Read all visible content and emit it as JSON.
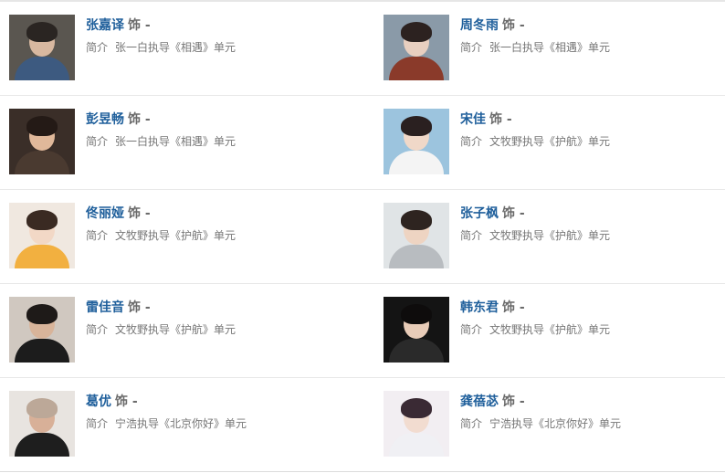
{
  "role_suffix": "饰 -",
  "intro_label": "简介",
  "cast": [
    {
      "name": "张嘉译",
      "intro": "张一白执导《相遇》单元",
      "colors": {
        "bg": "#5a5650",
        "skin": "#d8b8a0",
        "hair": "#2a2522",
        "shirt": "#3d5a80"
      }
    },
    {
      "name": "周冬雨",
      "intro": "张一白执导《相遇》单元",
      "colors": {
        "bg": "#8a9aa8",
        "skin": "#e8cfc0",
        "hair": "#2c2220",
        "shirt": "#8a3a2a"
      }
    },
    {
      "name": "彭昱畅",
      "intro": "张一白执导《相遇》单元",
      "colors": {
        "bg": "#3a2e28",
        "skin": "#e0b89a",
        "hair": "#241a16",
        "shirt": "#4a3a30"
      }
    },
    {
      "name": "宋佳",
      "intro": "文牧野执导《护航》单元",
      "colors": {
        "bg": "#9cc4de",
        "skin": "#f0d8c8",
        "hair": "#2a2020",
        "shirt": "#f4f4f4"
      }
    },
    {
      "name": "佟丽娅",
      "intro": "文牧野执导《护航》单元",
      "colors": {
        "bg": "#f0e8e0",
        "skin": "#f2d8c6",
        "hair": "#3a2a22",
        "shirt": "#f2b040"
      }
    },
    {
      "name": "张子枫",
      "intro": "文牧野执导《护航》单元",
      "colors": {
        "bg": "#e0e4e6",
        "skin": "#eed4c2",
        "hair": "#2e2420",
        "shirt": "#b8bcc0"
      }
    },
    {
      "name": "雷佳音",
      "intro": "文牧野执导《护航》单元",
      "colors": {
        "bg": "#d0c8c0",
        "skin": "#d8b49a",
        "hair": "#1e1a18",
        "shirt": "#1c1c1c"
      }
    },
    {
      "name": "韩东君",
      "intro": "文牧野执导《护航》单元",
      "colors": {
        "bg": "#141414",
        "skin": "#e8ccb8",
        "hair": "#0e0c0c",
        "shirt": "#2a2a2a"
      }
    },
    {
      "name": "葛优",
      "intro": "宁浩执导《北京你好》单元",
      "colors": {
        "bg": "#e8e4e0",
        "skin": "#d8b098",
        "hair": "#bca898",
        "shirt": "#1e1e1e"
      }
    },
    {
      "name": "龚蓓苾",
      "intro": "宁浩执导《北京你好》单元",
      "colors": {
        "bg": "#f2eef2",
        "skin": "#f2dcd0",
        "hair": "#3a2a34",
        "shirt": "#f0f0f4"
      }
    }
  ]
}
